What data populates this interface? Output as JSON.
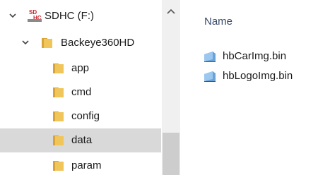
{
  "tree": {
    "drive": {
      "label": "SDHC (F:)",
      "icon": "sdhc-drive-icon",
      "icon_text_top": "SD",
      "icon_text_bottom": "HC"
    },
    "root_folder": {
      "label": "Backeye360HD",
      "icon": "folder-icon"
    },
    "folders": [
      {
        "label": "app",
        "icon": "folder-icon",
        "selected": false
      },
      {
        "label": "cmd",
        "icon": "folder-icon",
        "selected": false
      },
      {
        "label": "config",
        "icon": "folder-icon",
        "selected": false
      },
      {
        "label": "data",
        "icon": "folder-icon",
        "selected": true
      },
      {
        "label": "param",
        "icon": "folder-icon",
        "selected": false
      }
    ]
  },
  "content": {
    "column_header": "Name",
    "files": [
      {
        "name": "hbCarImg.bin",
        "icon": "bin-file-icon"
      },
      {
        "name": "hbLogoImg.bin",
        "icon": "bin-file-icon"
      }
    ]
  },
  "colors": {
    "folder": "#e8b84a",
    "selection": "#d9d9d9",
    "header_text": "#3a4a6b",
    "sd_red": "#c8242a"
  }
}
